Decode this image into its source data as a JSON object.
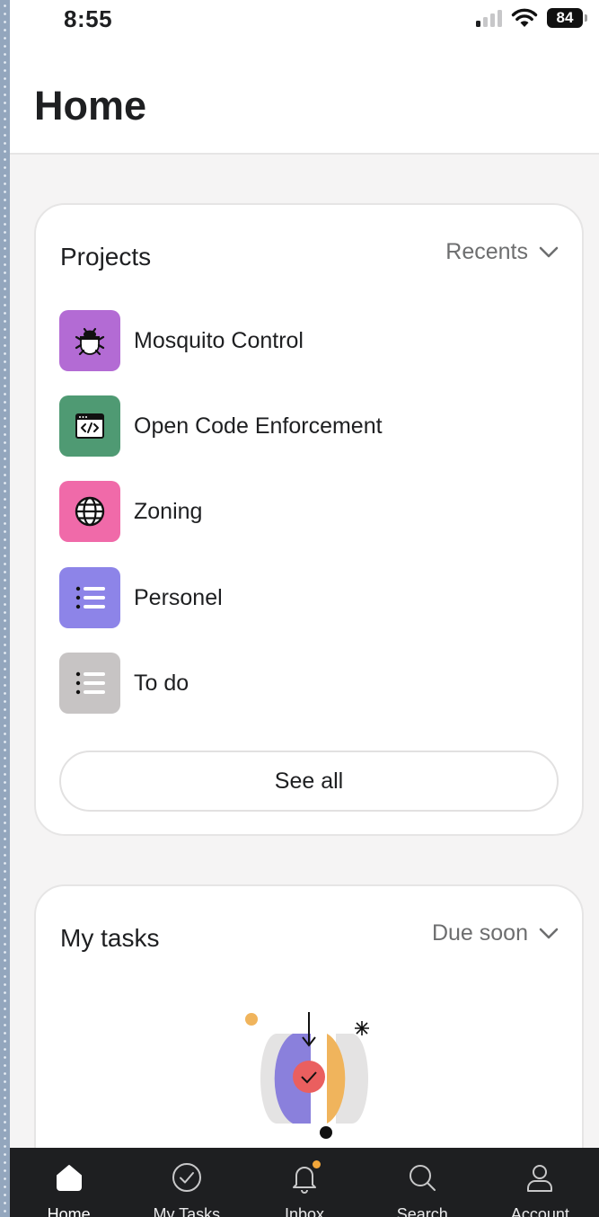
{
  "status_bar": {
    "time": "8:55",
    "battery": "84"
  },
  "header": {
    "title": "Home"
  },
  "projects": {
    "title": "Projects",
    "sort_label": "Recents",
    "items": [
      {
        "name": "Mosquito Control",
        "icon": "bug-icon",
        "color": "#b36bd4"
      },
      {
        "name": "Open Code Enforcement",
        "icon": "code-window-icon",
        "color": "#4f9a73"
      },
      {
        "name": "Zoning",
        "icon": "globe-icon",
        "color": "#f06aa9"
      },
      {
        "name": "Personel",
        "icon": "list-icon",
        "color": "#8d84e8"
      },
      {
        "name": "To do",
        "icon": "list-icon",
        "color": "#c7c4c4"
      }
    ],
    "see_all_label": "See all"
  },
  "my_tasks": {
    "title": "My tasks",
    "sort_label": "Due soon"
  },
  "tabbar": {
    "items": [
      {
        "label": "Home",
        "icon": "home-icon",
        "active": true
      },
      {
        "label": "My Tasks",
        "icon": "check-circle-icon",
        "active": false
      },
      {
        "label": "Inbox",
        "icon": "bell-icon",
        "active": false,
        "badge": true
      },
      {
        "label": "Search",
        "icon": "search-icon",
        "active": false
      },
      {
        "label": "Account",
        "icon": "person-icon",
        "active": false
      }
    ]
  },
  "colors": {
    "accent_badge": "#f1a63a",
    "tabbar_bg": "#1e1f21"
  }
}
